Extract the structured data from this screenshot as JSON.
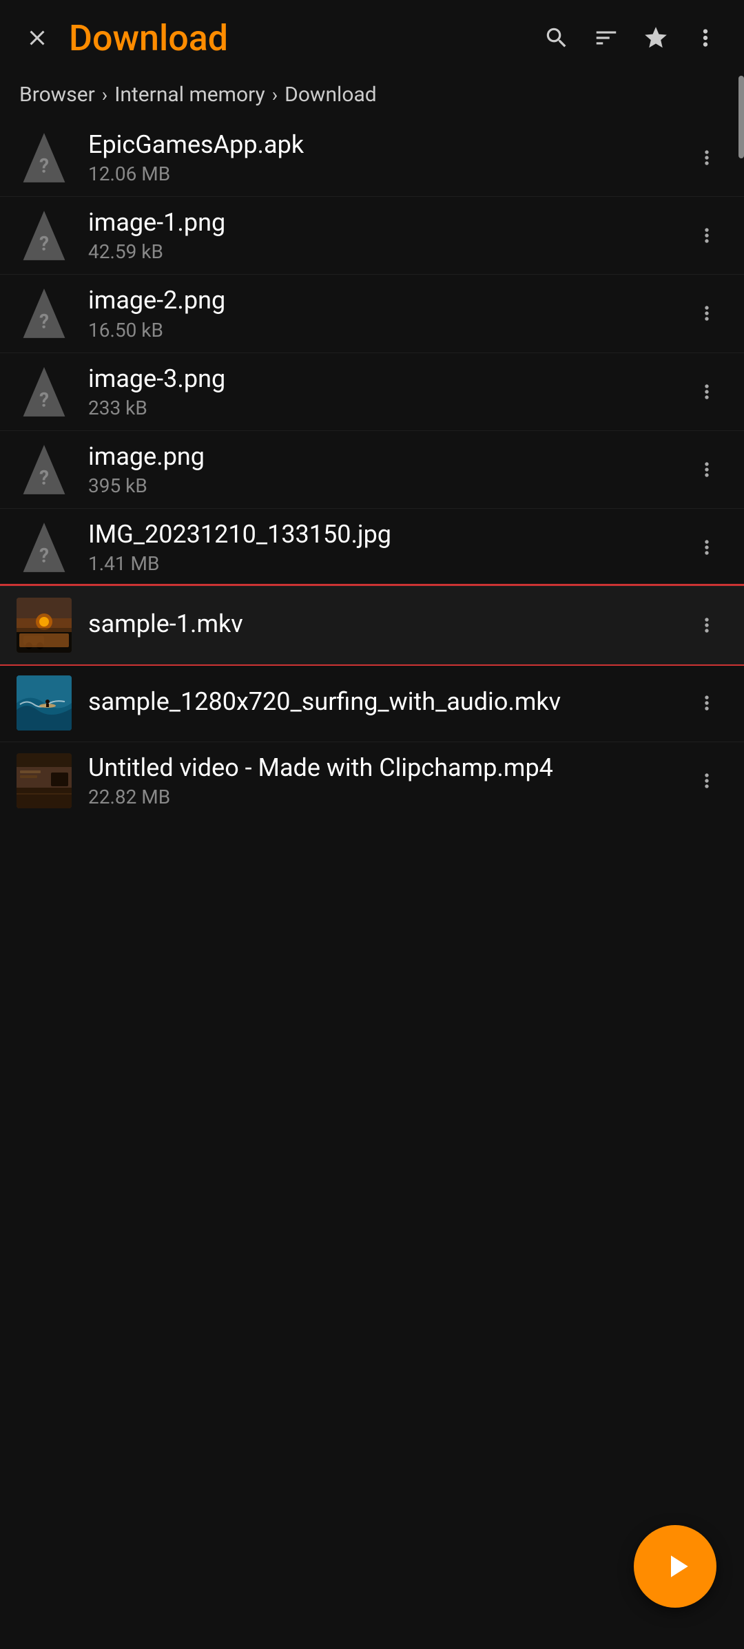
{
  "header": {
    "title": "Download",
    "close_label": "close",
    "search_label": "search",
    "sort_label": "sort",
    "star_label": "star",
    "more_label": "more options"
  },
  "breadcrumb": {
    "items": [
      {
        "label": "Browser",
        "id": "browser"
      },
      {
        "label": "Internal memory",
        "id": "internal-memory"
      },
      {
        "label": "Download",
        "id": "download"
      }
    ]
  },
  "files": [
    {
      "id": "epicgames",
      "name": "EpicGamesApp.apk",
      "size": "12.06 MB",
      "type": "unknown",
      "selected": false
    },
    {
      "id": "image1",
      "name": "image-1.png",
      "size": "42.59 kB",
      "type": "unknown",
      "selected": false
    },
    {
      "id": "image2",
      "name": "image-2.png",
      "size": "16.50 kB",
      "type": "unknown",
      "selected": false
    },
    {
      "id": "image3",
      "name": "image-3.png",
      "size": "233 kB",
      "type": "unknown",
      "selected": false
    },
    {
      "id": "imagepng",
      "name": "image.png",
      "size": "395 kB",
      "type": "unknown",
      "selected": false
    },
    {
      "id": "img20231210",
      "name": "IMG_20231210_133150.jpg",
      "size": "1.41 MB",
      "type": "unknown",
      "selected": false
    },
    {
      "id": "sample1mkv",
      "name": "sample-1.mkv",
      "size": "",
      "type": "video-sample1",
      "selected": true
    },
    {
      "id": "surfingmkv",
      "name": "sample_1280x720_surfing_with_audio.mkv",
      "size": "",
      "type": "video-surfing",
      "selected": false
    },
    {
      "id": "clipchamp",
      "name": "Untitled video - Made with Clipchamp.mp4",
      "size": "22.82 MB",
      "type": "video-clipchamp",
      "selected": false
    }
  ],
  "fab": {
    "label": "Play"
  }
}
